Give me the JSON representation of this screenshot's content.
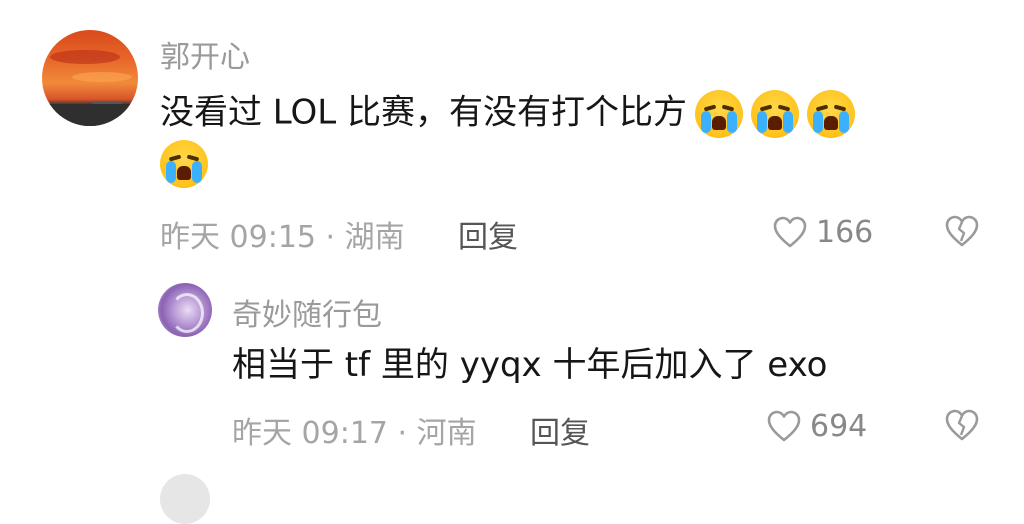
{
  "comments": [
    {
      "username": "郭开心",
      "text_line1": "没看过 LOL 比赛，有没有打个比方",
      "emoji_name": "loudly-crying-face-emoji",
      "meta": "昨天 09:15 · 湖南",
      "reply_label": "回复",
      "likes": "166"
    },
    {
      "username": "奇妙随行包",
      "text_line1": "相当于 tf 里的 yyqx 十年后加入了 exo",
      "meta": "昨天 09:17 · 河南",
      "reply_label": "回复",
      "likes": "694"
    }
  ],
  "icons": {
    "like": "heart-outline-icon",
    "dislike": "broken-heart-outline-icon"
  },
  "colors": {
    "text": "#161616",
    "muted": "#a5a5a5",
    "emoji": "#ffc21a",
    "tear": "#3ab0ff"
  }
}
